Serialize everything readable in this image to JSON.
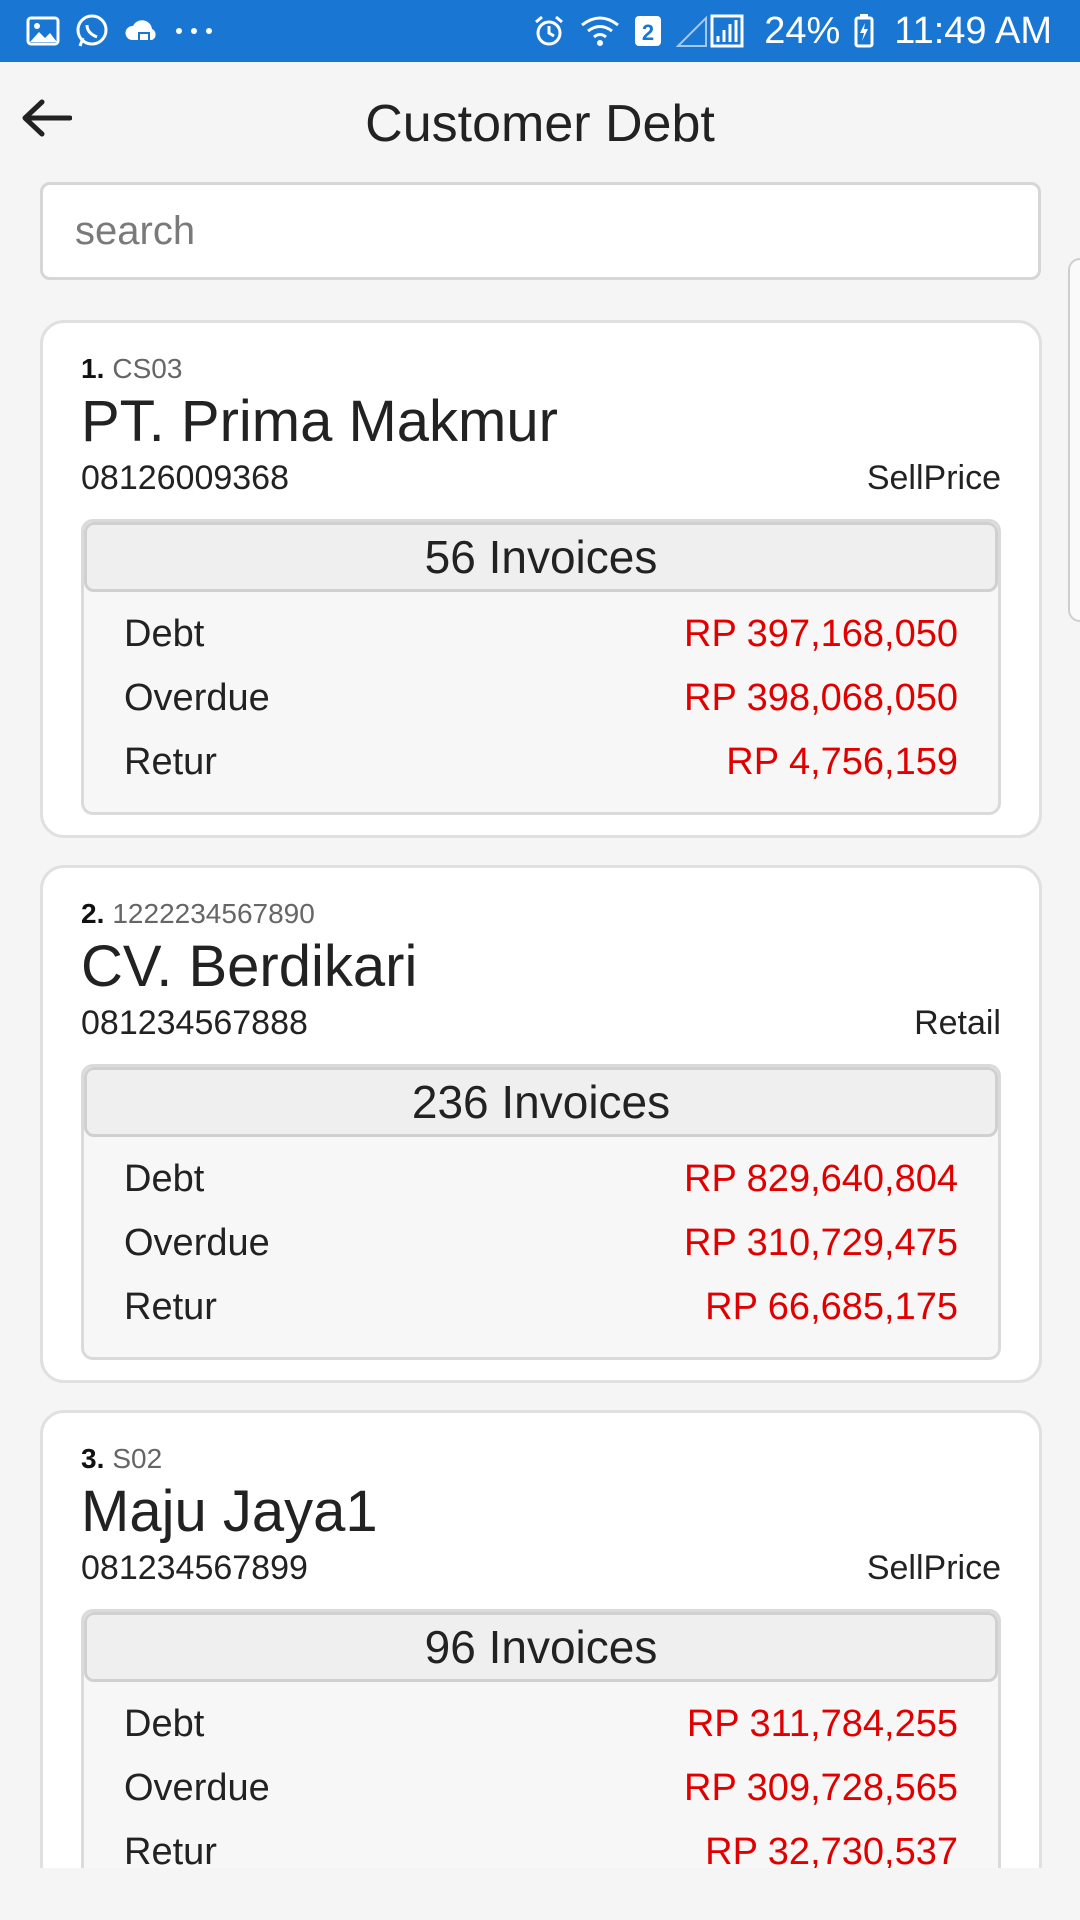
{
  "status_bar": {
    "left_icons": [
      "gallery-icon",
      "whatsapp-icon",
      "cloud-icon",
      "more-dots-icon"
    ],
    "right_icons": [
      "alarm-icon",
      "wifi-icon",
      "sim-2-icon",
      "signal-icon",
      "battery-icon"
    ],
    "sim_badge": "2",
    "battery": "24%",
    "time": "11:49 AM",
    "bg_color": "#1976d2"
  },
  "header": {
    "title": "Customer Debt",
    "back_icon": "arrow-left-icon"
  },
  "search": {
    "placeholder": "search",
    "value": ""
  },
  "colors": {
    "amount": "#e00000",
    "accent": "#1976d2"
  },
  "customers": [
    {
      "index": "1.",
      "code": "CS03",
      "name": "PT. Prima Makmur",
      "phone": "08126009368",
      "price_type": "SellPrice",
      "invoices": "56 Invoices",
      "debt_label": "Debt",
      "debt": "RP 397,168,050",
      "overdue_label": "Overdue",
      "overdue": "RP 398,068,050",
      "retur_label": "Retur",
      "retur": "RP 4,756,159"
    },
    {
      "index": "2.",
      "code": "1222234567890",
      "name": "CV. Berdikari",
      "phone": "081234567888",
      "price_type": "Retail",
      "invoices": "236 Invoices",
      "debt_label": "Debt",
      "debt": "RP 829,640,804",
      "overdue_label": "Overdue",
      "overdue": "RP 310,729,475",
      "retur_label": "Retur",
      "retur": "RP 66,685,175"
    },
    {
      "index": "3.",
      "code": "S02",
      "name": "Maju Jaya1",
      "phone": "081234567899",
      "price_type": "SellPrice",
      "invoices": "96 Invoices",
      "debt_label": "Debt",
      "debt": "RP 311,784,255",
      "overdue_label": "Overdue",
      "overdue": "RP 309,728,565",
      "retur_label": "Retur",
      "retur": "RP 32,730,537"
    }
  ]
}
